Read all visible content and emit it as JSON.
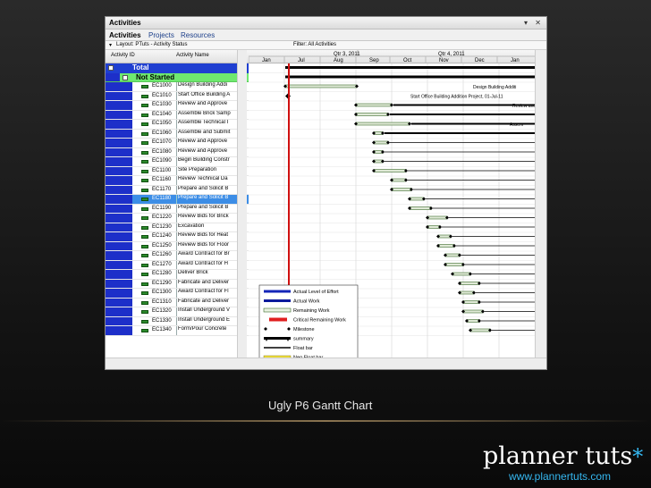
{
  "window": {
    "title": "Activities",
    "controls": "▾ ✕"
  },
  "tabs": [
    {
      "label": "Activities"
    },
    {
      "label": "Projects"
    },
    {
      "label": "Resources"
    }
  ],
  "layout_label": "Layout: PTuts - Activity Status",
  "filter_label": "Filter: All Activities",
  "columns": {
    "id": "Activity ID",
    "name": "Activity Name"
  },
  "timescale": {
    "quarters": [
      "Qtr 3, 2011",
      "Qtr 4, 2011"
    ],
    "months": [
      "Jan",
      "Jul",
      "Aug",
      "Sep",
      "Oct",
      "Nov",
      "Dec",
      "Jan"
    ]
  },
  "total_label": "Total",
  "group_label": "Not Started",
  "activities": [
    {
      "id": "EC1000",
      "name": "Design Building Addi",
      "bar_label": "Design Building Additi"
    },
    {
      "id": "EC1010",
      "name": "Start Office Building A",
      "bar_label": "Start Office Building Addition Project, 01-Jul-11"
    },
    {
      "id": "EC1030",
      "name": "Review and Approve",
      "bar_label": "Review and"
    },
    {
      "id": "EC1040",
      "name": "Assemble Brick Samp",
      "bar_label": ""
    },
    {
      "id": "EC1050",
      "name": "Assemble Technical I",
      "bar_label": "Assem"
    },
    {
      "id": "EC1060",
      "name": "Assemble and Submit",
      "bar_label": ""
    },
    {
      "id": "EC1070",
      "name": "Review and Approve",
      "bar_label": ""
    },
    {
      "id": "EC1080",
      "name": "Review and Approve",
      "bar_label": ""
    },
    {
      "id": "EC1090",
      "name": "Begin Building Constr",
      "bar_label": ""
    },
    {
      "id": "EC1100",
      "name": "Site Preparation",
      "bar_label": ""
    },
    {
      "id": "EC1160",
      "name": "Review Technical Da",
      "bar_label": ""
    },
    {
      "id": "EC1170",
      "name": "Prepare and Solicit B",
      "bar_label": ""
    },
    {
      "id": "EC1180",
      "name": "Prepare and Solicit B",
      "bar_label": ""
    },
    {
      "id": "EC1190",
      "name": "Prepare and Solicit B",
      "bar_label": ""
    },
    {
      "id": "EC1220",
      "name": "Review Bids for Brick",
      "bar_label": ""
    },
    {
      "id": "EC1230",
      "name": "Excavation",
      "bar_label": ""
    },
    {
      "id": "EC1240",
      "name": "Review Bids for Heat",
      "bar_label": ""
    },
    {
      "id": "EC1250",
      "name": "Review Bids for Floor",
      "bar_label": ""
    },
    {
      "id": "EC1260",
      "name": "Award Contract for Br",
      "bar_label": ""
    },
    {
      "id": "EC1270",
      "name": "Award Contract for H",
      "bar_label": ""
    },
    {
      "id": "EC1280",
      "name": "Deliver Brick",
      "bar_label": ""
    },
    {
      "id": "EC1290",
      "name": "Fabricate and Deliver",
      "bar_label": ""
    },
    {
      "id": "EC1300",
      "name": "Award Contract for Fl",
      "bar_label": ""
    },
    {
      "id": "EC1310",
      "name": "Fabricate and Deliver",
      "bar_label": ""
    },
    {
      "id": "EC1320",
      "name": "Install Underground V",
      "bar_label": ""
    },
    {
      "id": "EC1330",
      "name": "Install Underground E",
      "bar_label": ""
    },
    {
      "id": "EC1340",
      "name": "Form/Pour Concrete",
      "bar_label": ""
    }
  ],
  "selected_activity": "EC1180",
  "legend": [
    {
      "label": "Actual Level of Effort",
      "style": "loe"
    },
    {
      "label": "Actual Work",
      "style": "actual"
    },
    {
      "label": "Remaining Work",
      "style": "remaining"
    },
    {
      "label": "Critical Remaining Work",
      "style": "critical"
    },
    {
      "label": "Milestone",
      "style": "milestone"
    },
    {
      "label": "summary",
      "style": "summary"
    },
    {
      "label": "Float bar",
      "style": "float"
    },
    {
      "label": "Neg Float bar",
      "style": "negfloat"
    }
  ],
  "colors": {
    "gutter": "#1d2fc9",
    "total_row": "#1f3fd1",
    "group_row": "#6fe86f",
    "selected_row": "#3c8de6",
    "data_date": "#d01010",
    "brand_accent": "#35b7f0"
  },
  "caption": "Ugly P6 Gantt Chart",
  "brand": {
    "name": "planner tuts",
    "star": "*",
    "url": "www.plannertuts.com"
  }
}
